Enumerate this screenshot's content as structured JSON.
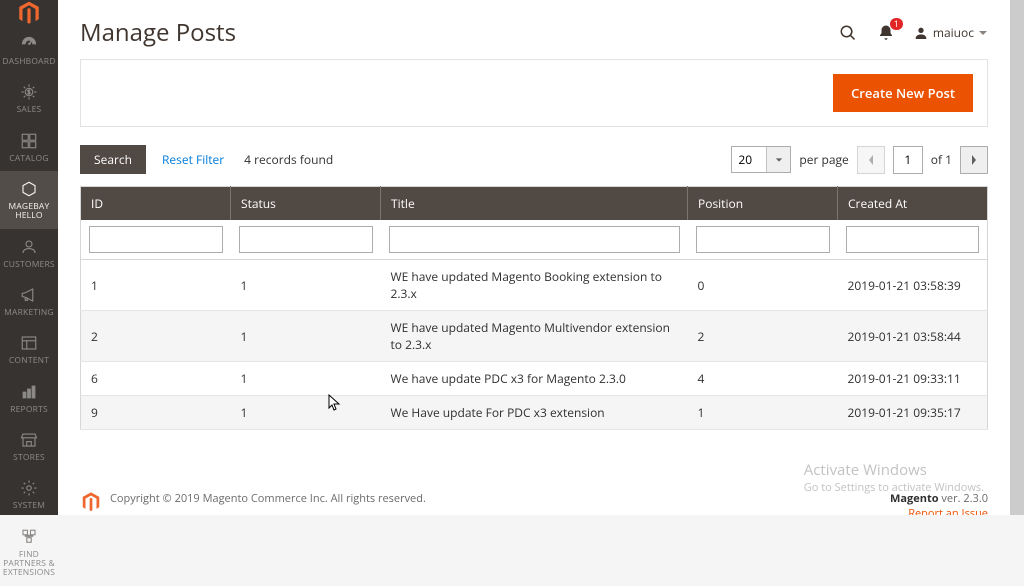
{
  "sidebar": {
    "items": [
      {
        "label": "DASHBOARD"
      },
      {
        "label": "SALES"
      },
      {
        "label": "CATALOG"
      },
      {
        "label": "MAGEBAY HELLO"
      },
      {
        "label": "CUSTOMERS"
      },
      {
        "label": "MARKETING"
      },
      {
        "label": "CONTENT"
      },
      {
        "label": "REPORTS"
      },
      {
        "label": "STORES"
      },
      {
        "label": "SYSTEM"
      },
      {
        "label": "FIND PARTNERS & EXTENSIONS"
      }
    ]
  },
  "header": {
    "title": "Manage Posts",
    "notification_count": "1",
    "user_name": "maiuoc"
  },
  "actions": {
    "create_label": "Create New Post"
  },
  "toolbar": {
    "search_label": "Search",
    "reset_label": "Reset Filter",
    "records_found": "4 records found",
    "page_size": "20",
    "per_page_label": "per page",
    "current_page": "1",
    "of_label": "of 1"
  },
  "table": {
    "headers": {
      "id": "ID",
      "status": "Status",
      "title": "Title",
      "position": "Position",
      "created": "Created At"
    },
    "rows": [
      {
        "id": "1",
        "status": "1",
        "title": "WE have updated Magento Booking extension to 2.3.x",
        "position": "0",
        "created": "2019-01-21 03:58:39"
      },
      {
        "id": "2",
        "status": "1",
        "title": "WE have updated Magento Multivendor extension to 2.3.x",
        "position": "2",
        "created": "2019-01-21 03:58:44"
      },
      {
        "id": "6",
        "status": "1",
        "title": "We have update PDC x3 for Magento 2.3.0",
        "position": "4",
        "created": "2019-01-21 09:33:11"
      },
      {
        "id": "9",
        "status": "1",
        "title": "We Have update For PDC x3 extension",
        "position": "1",
        "created": "2019-01-21 09:35:17"
      }
    ]
  },
  "footer": {
    "copyright": "Copyright © 2019 Magento Commerce Inc. All rights reserved.",
    "product": "Magento",
    "version": " ver. 2.3.0",
    "report_label": "Report an Issue"
  },
  "watermark": {
    "title": "Activate Windows",
    "subtitle": "Go to Settings to activate Windows."
  }
}
